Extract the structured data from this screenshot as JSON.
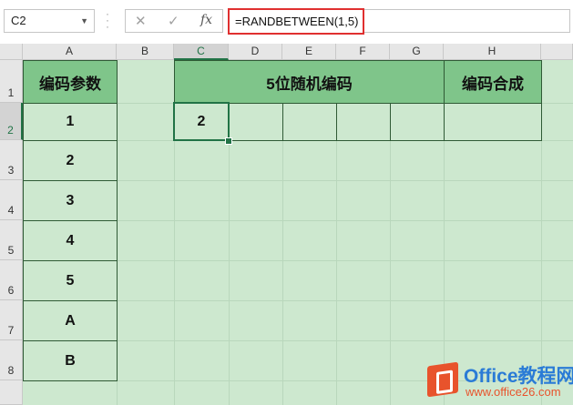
{
  "name_box": {
    "value": "C2",
    "dropdown_icon": "chevron-down-icon"
  },
  "formula_bar": {
    "cancel_icon": "cancel-x-icon",
    "enter_icon": "checkmark-icon",
    "fx_label": "fx",
    "formula": "=RANDBETWEEN(1,5)"
  },
  "columns": [
    "A",
    "B",
    "C",
    "D",
    "E",
    "F",
    "G",
    "H"
  ],
  "rows": [
    "1",
    "2",
    "3",
    "4",
    "5",
    "6",
    "7",
    "8"
  ],
  "selected_column": "C",
  "selected_row": "2",
  "cells": {
    "A1": "编码参数",
    "A2": "1",
    "A3": "2",
    "A4": "3",
    "A5": "4",
    "A6": "5",
    "A7": "A",
    "A8": "B",
    "C1": "5位随机编码",
    "H1": "编码合成",
    "C2": "2"
  },
  "watermark": {
    "title": "Office教程网",
    "url": "www.office26.com"
  },
  "colors": {
    "sheet_bg": "#cde8cf",
    "header_fill": "#7fc58a",
    "selection": "#217346",
    "formula_highlight": "#e03030",
    "watermark_orange": "#e8532c",
    "watermark_blue": "#2a7bd6"
  }
}
